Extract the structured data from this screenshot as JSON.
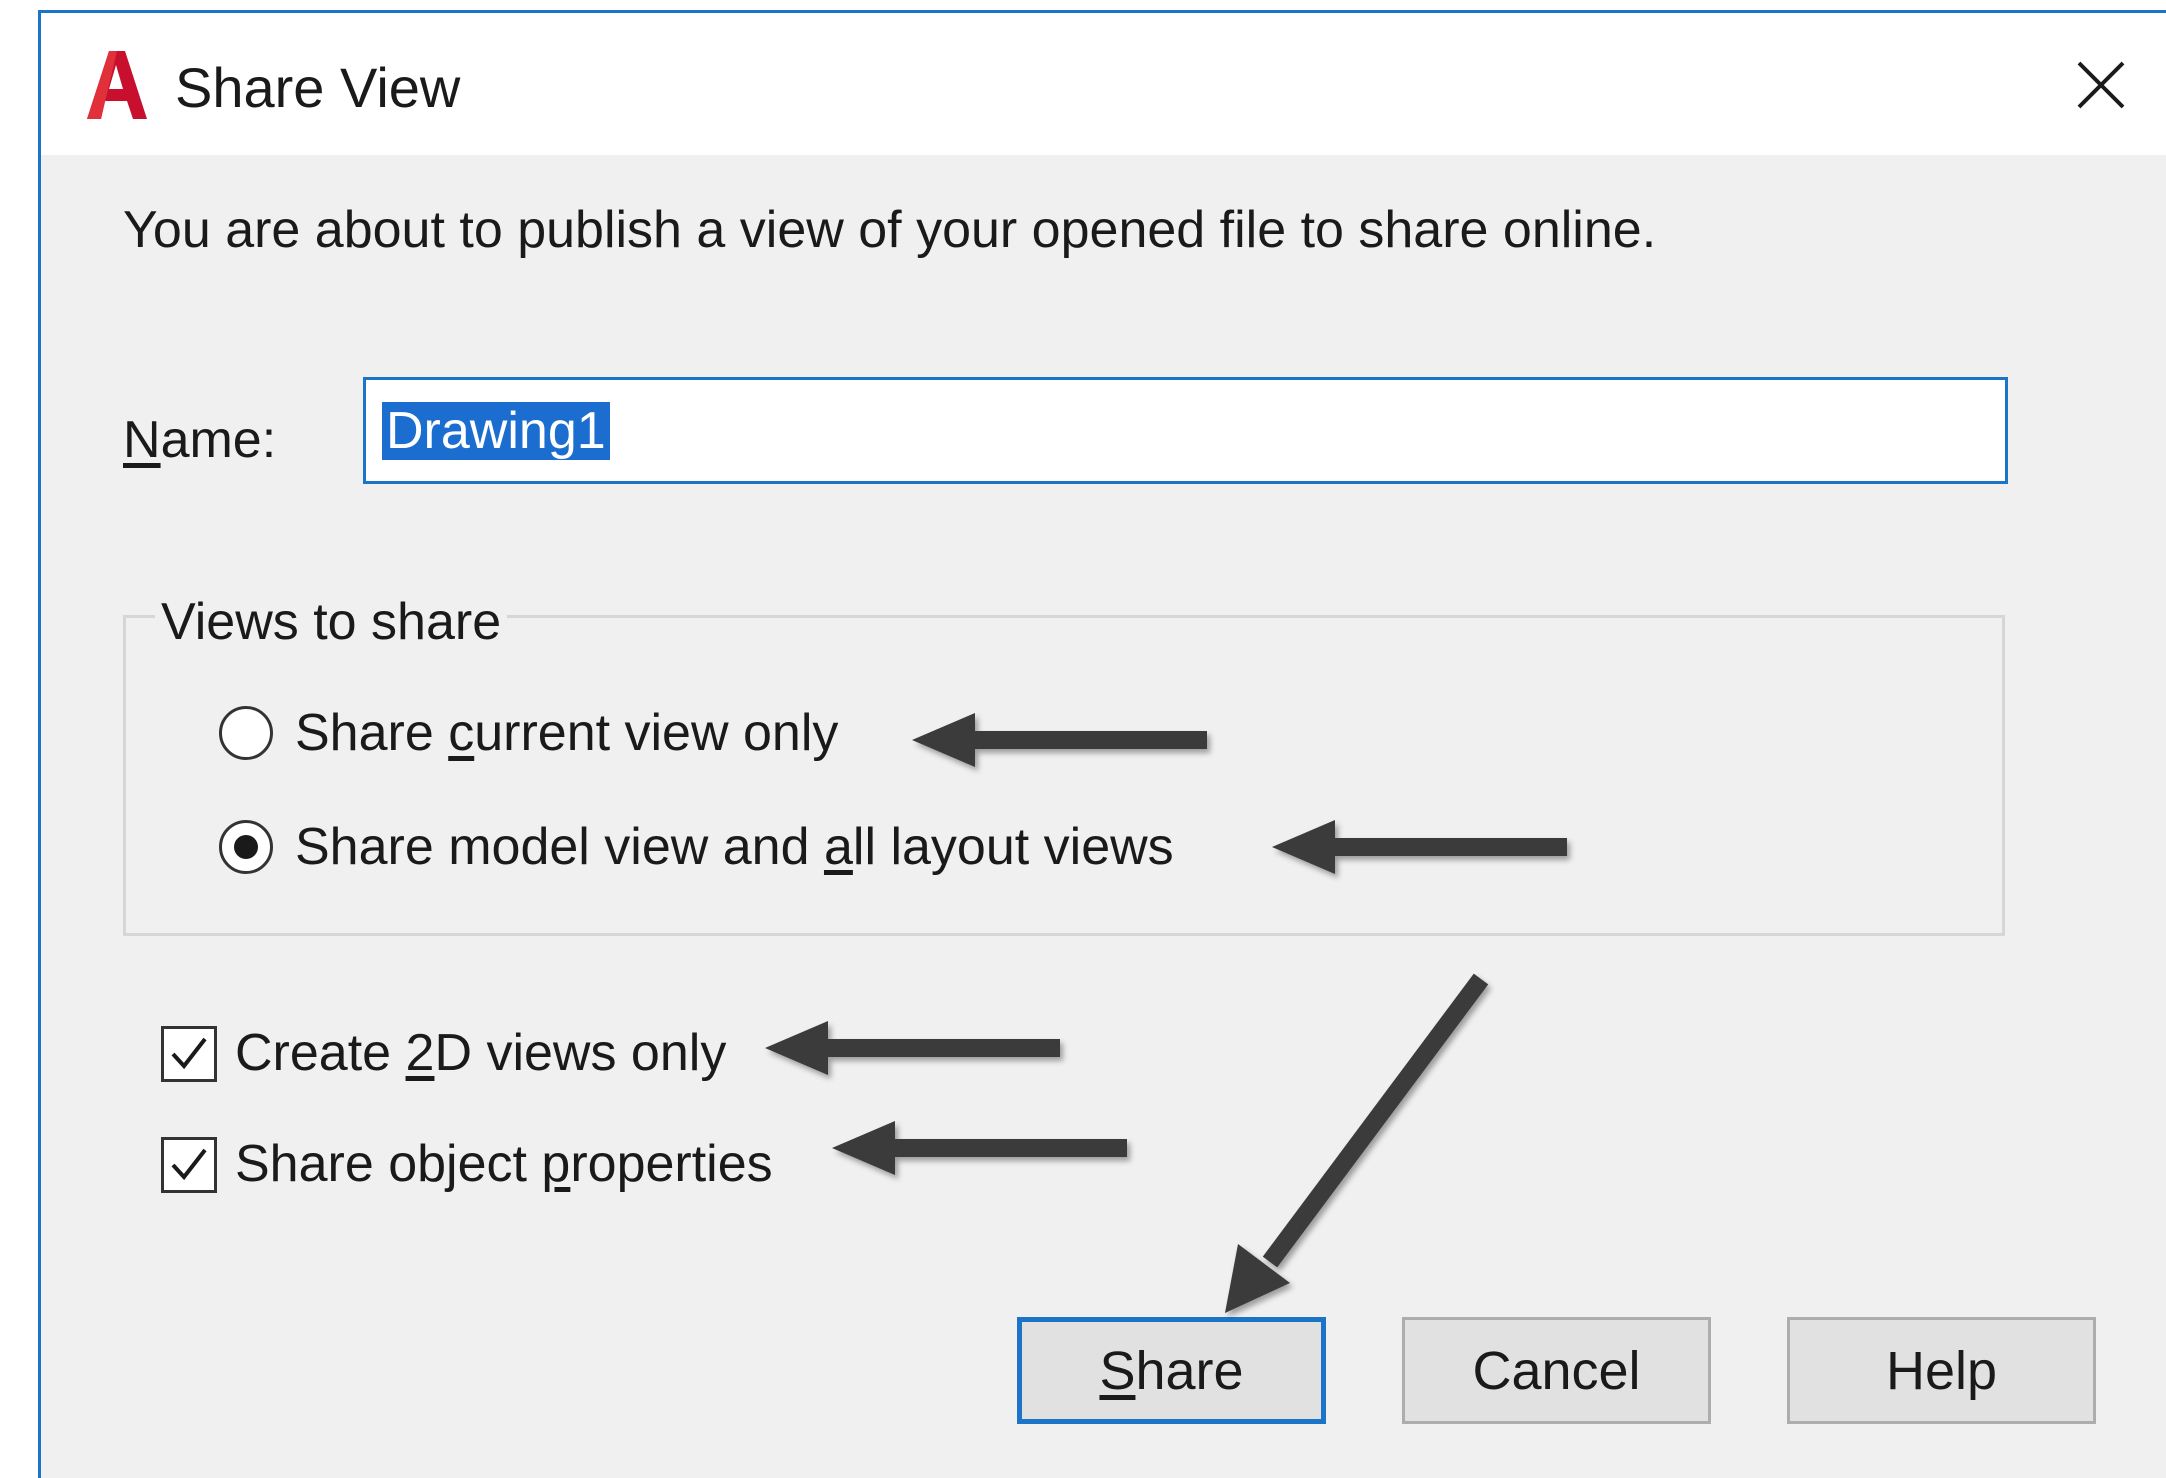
{
  "dialog": {
    "title": "Share View",
    "intro": "You are about to publish a view of your opened file to share online."
  },
  "name_field": {
    "label_mnemonic": "N",
    "label_rest": "ame:",
    "value": "Drawing1"
  },
  "views_group": {
    "title": "Views to share",
    "options": [
      {
        "pre": "Share ",
        "mnemonic": "c",
        "post": "urrent view only",
        "selected": false
      },
      {
        "pre": "Share model view and ",
        "mnemonic": "a",
        "post": "ll layout views",
        "selected": true
      }
    ]
  },
  "checkboxes": [
    {
      "pre": "Create ",
      "mnemonic": "2",
      "post": "D views only",
      "checked": true
    },
    {
      "pre": "Share object ",
      "mnemonic": "p",
      "post": "roperties",
      "checked": true
    }
  ],
  "buttons": {
    "share_mnemonic": "S",
    "share_rest": "hare",
    "cancel": "Cancel",
    "help": "Help"
  },
  "colors": {
    "accent": "#1c74c9",
    "selection": "#1b6ecf",
    "app_icon": "#c8102e",
    "annotation_arrow": "#3a3a3a"
  },
  "icons": {
    "app": "autocad-a-icon",
    "close": "close-icon"
  }
}
